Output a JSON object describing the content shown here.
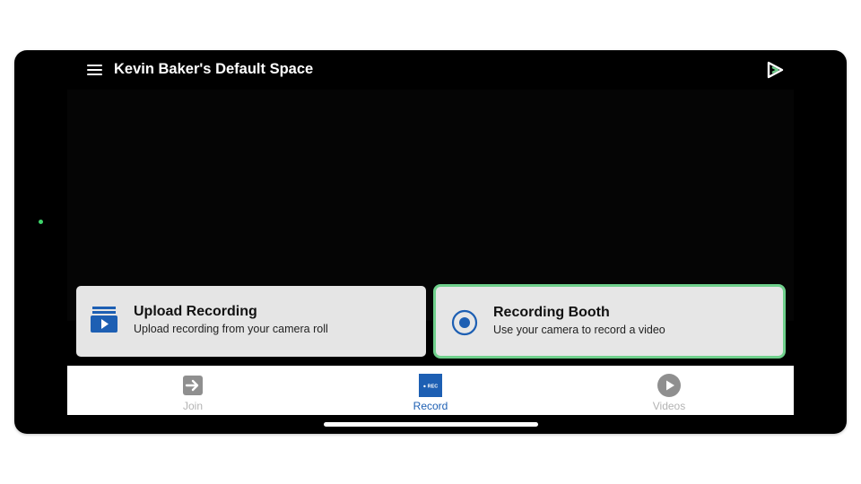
{
  "header": {
    "title": "Kevin Baker's Default Space",
    "menu_icon": "hamburger-menu-icon",
    "brand_icon": "app-logo-icon"
  },
  "actions": {
    "upload": {
      "title": "Upload Recording",
      "subtitle": "Upload recording from your camera roll",
      "icon": "upload-video-icon"
    },
    "booth": {
      "title": "Recording Booth",
      "subtitle": "Use your camera to record a video",
      "icon": "record-radio-icon",
      "selected": true
    }
  },
  "tabs": [
    {
      "label": "Join",
      "icon": "join-arrow-icon",
      "active": false
    },
    {
      "label": "Record",
      "icon": "rec-badge-icon",
      "badge_text": "● REC",
      "active": true
    },
    {
      "label": "Videos",
      "icon": "play-circle-icon",
      "active": false
    }
  ],
  "colors": {
    "accent_blue": "#1d5fb3",
    "selected_border": "#6fd08c",
    "camera_indicator": "#3ed36b",
    "inactive_tab": "#b3b3b3"
  }
}
